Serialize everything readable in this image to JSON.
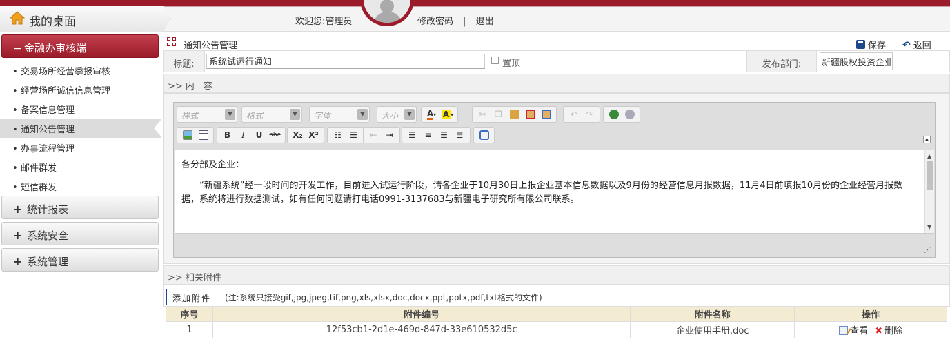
{
  "header": {
    "desk_title": "我的桌面",
    "welcome": "欢迎您:管理员",
    "change_password": "修改密码",
    "separator": "|",
    "logout": "退出",
    "brand_color": "#9b1b2a"
  },
  "sidebar": {
    "active_group": {
      "sign": "−",
      "label": "金融办审核端"
    },
    "items": [
      {
        "label": "交易场所经营季报审核"
      },
      {
        "label": "经营场所诚信信息管理"
      },
      {
        "label": "备案信息管理"
      },
      {
        "label": "通知公告管理"
      },
      {
        "label": "办事流程管理"
      },
      {
        "label": "邮件群发"
      },
      {
        "label": "短信群发"
      }
    ],
    "groups": [
      {
        "sign": "+",
        "label": "统计报表"
      },
      {
        "sign": "+",
        "label": "系统安全"
      },
      {
        "sign": "+",
        "label": "系统管理"
      }
    ]
  },
  "panel": {
    "title": "通知公告管理",
    "save_label": "保存",
    "back_label": "返回"
  },
  "form": {
    "title_label": "标题:",
    "title_value": "系统试运行通知",
    "pin_label": "置顶",
    "dept_label": "发布部门:",
    "dept_value": "新疆股权投资企业"
  },
  "content_section": ">> 内　容",
  "editor": {
    "style_placeholder": "样式",
    "format_placeholder": "格式",
    "font_placeholder": "字体",
    "size_placeholder": "大小",
    "bold": "B",
    "italic": "I",
    "underline": "U",
    "strike": "abc",
    "subscript": "X₂",
    "superscript": "X²",
    "text_color_label": "A",
    "bg_color_label": "A",
    "greeting": "各分部及企业：",
    "body": "“新疆系统”经一段时间的开发工作，目前进入试运行阶段，请各企业于10月30日上报企业基本信息数据以及9月份的经营信息月报数据，11月4日前填报10月份的企业经营月报数据，系统将进行数据测试，如有任何问题请打电话0991-3137683与新疆电子研究所有限公司联系。"
  },
  "attach_section": ">> 相关附件",
  "attachments": {
    "add_label": "添加附件",
    "note": "(注:系统只接受gif,jpg,jpeg,tif,png,xls,xlsx,doc,docx,ppt,pptx,pdf,txt格式的文件)",
    "columns": [
      "序号",
      "附件编号",
      "附件名称",
      "操作"
    ],
    "rows": [
      {
        "index": "1",
        "code": "12f53cb1-2d1e-469d-847d-33e610532d5c",
        "name": "企业使用手册.doc",
        "view": "查看",
        "delete": "删除"
      }
    ]
  }
}
